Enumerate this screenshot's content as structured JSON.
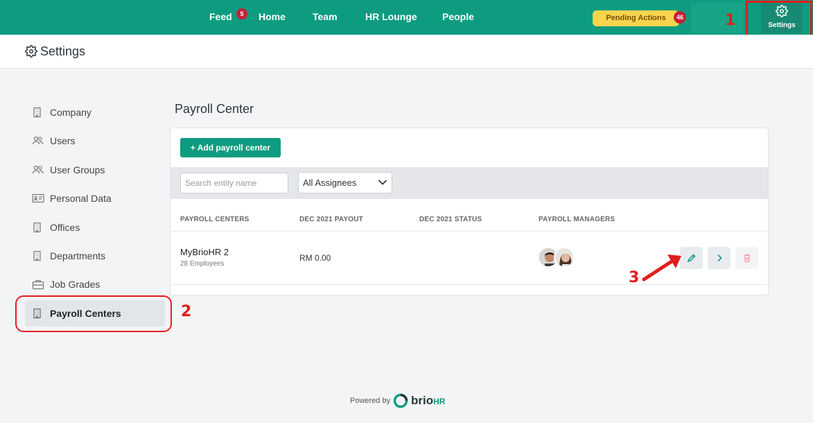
{
  "nav": {
    "items": [
      "Feed",
      "Home",
      "Team",
      "HR Lounge",
      "People"
    ],
    "feed_badge": "5",
    "pending_label": "Pending Actions",
    "pending_count": "46",
    "settings_label": "Settings"
  },
  "header": {
    "title": "Settings"
  },
  "sidebar": {
    "items": [
      {
        "label": "Company",
        "icon": "building-icon"
      },
      {
        "label": "Users",
        "icon": "users-icon"
      },
      {
        "label": "User Groups",
        "icon": "users-icon"
      },
      {
        "label": "Personal Data",
        "icon": "id-card-icon"
      },
      {
        "label": "Offices",
        "icon": "building-icon"
      },
      {
        "label": "Departments",
        "icon": "building-icon"
      },
      {
        "label": "Job Grades",
        "icon": "briefcase-icon"
      },
      {
        "label": "Payroll Centers",
        "icon": "building-icon",
        "active": true
      }
    ]
  },
  "main": {
    "title": "Payroll Center",
    "add_button": "+ Add payroll center",
    "search_placeholder": "Search entity name",
    "assignee_select": "All Assignees",
    "columns": [
      "PAYROLL CENTERS",
      "DEC 2021 PAYOUT",
      "DEC 2021 STATUS",
      "PAYROLL MANAGERS"
    ],
    "rows": [
      {
        "name": "MyBrioHR 2",
        "employees": "28 Employees",
        "payout": "RM 0.00",
        "status": ""
      }
    ]
  },
  "annotations": [
    "1",
    "2",
    "3"
  ],
  "footer": {
    "powered_by": "Powered by",
    "brand": "brio",
    "brand_suffix": "HR"
  },
  "colors": {
    "brand": "#0e9c80",
    "pending": "#f9d44e",
    "badge": "#c91f37",
    "annotation": "#e41c1c"
  }
}
